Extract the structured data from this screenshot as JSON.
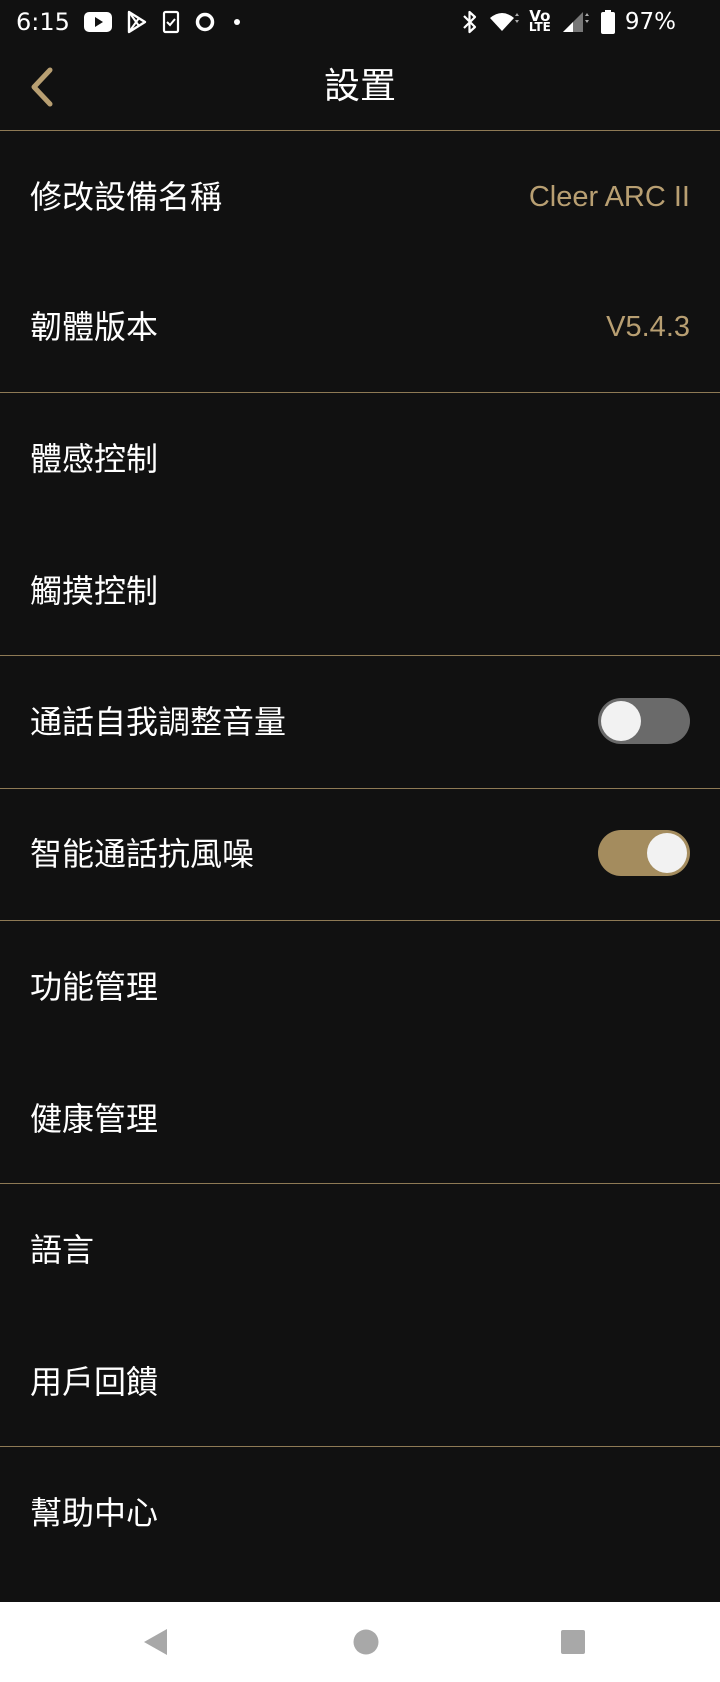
{
  "status_bar": {
    "time": "6:15",
    "battery_percent": "97%",
    "icons": [
      "youtube-icon",
      "play-store-icon",
      "clipboard-check-icon",
      "circle-icon",
      "dot-icon",
      "bluetooth-icon",
      "wifi-icon",
      "volte-icon",
      "signal-icon",
      "battery-icon"
    ],
    "volte_label_top": "Vo",
    "volte_label_bottom": "LTE"
  },
  "header": {
    "title": "設置",
    "back_icon": "chevron-left-icon"
  },
  "colors": {
    "background": "#111111",
    "accent": "#b89f72",
    "divider": "#8e7a55",
    "toggle_on": "#a48c5e",
    "toggle_off": "#6a6a6a"
  },
  "settings": {
    "device_name_label": "修改設備名稱",
    "device_name_value": "Cleer ARC II",
    "firmware_label": "韌體版本",
    "firmware_value": "V5.4.3",
    "motion_control_label": "體感控制",
    "touch_control_label": "觸摸控制",
    "call_volume_label": "通話自我調整音量",
    "call_volume_enabled": false,
    "wind_noise_label": "智能通話抗風噪",
    "wind_noise_enabled": true,
    "feature_mgmt_label": "功能管理",
    "health_mgmt_label": "健康管理",
    "language_label": "語言",
    "feedback_label": "用戶回饋",
    "help_center_label": "幫助中心"
  },
  "nav_bar": {
    "icons": [
      "nav-back-icon",
      "nav-home-icon",
      "nav-recents-icon"
    ]
  }
}
